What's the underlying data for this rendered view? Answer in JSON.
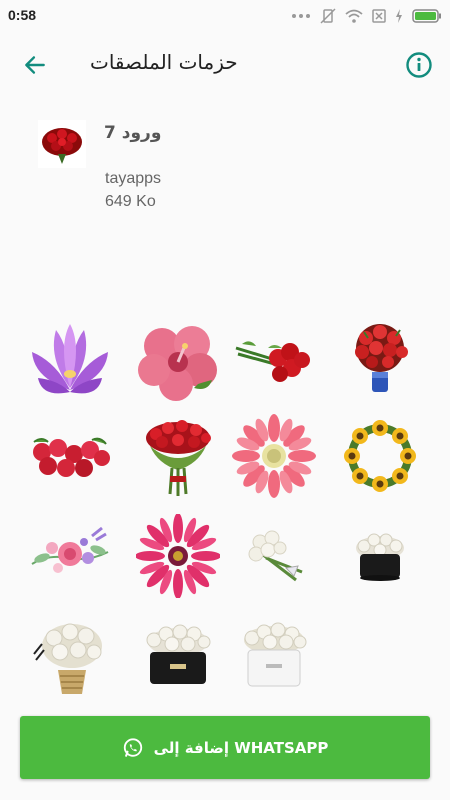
{
  "status_bar": {
    "time": "0:58",
    "icons": [
      "dots-icon",
      "rotation-lock-icon",
      "wifi-icon",
      "sim-icon",
      "charging-icon",
      "battery-icon"
    ]
  },
  "app_bar": {
    "title": "حزمات الملصقات",
    "back_icon": "arrow-left-icon",
    "info_icon": "info-icon"
  },
  "pack": {
    "name": "ورود 7",
    "author": "tayapps",
    "size": "649 Ko"
  },
  "stickers": [
    "purple-lotus",
    "pink-hibiscus",
    "red-rose-bouquet-lying",
    "red-roses-vase",
    "red-roses-row",
    "red-rose-ball-bouquet",
    "pink-gerbera",
    "sunflower-wreath",
    "watercolor-flowers",
    "magenta-daisy",
    "white-roses-bouquet-lying",
    "white-roses-black-box",
    "white-roses-basket",
    "white-roses-black-round-box",
    "white-roses-white-box"
  ],
  "add_button": {
    "label": "إضافة إلى WHATSAPP",
    "icon": "whatsapp-icon",
    "color": "#4cba3f"
  },
  "colors": {
    "accent": "#128c7e",
    "background": "#fafafa"
  }
}
